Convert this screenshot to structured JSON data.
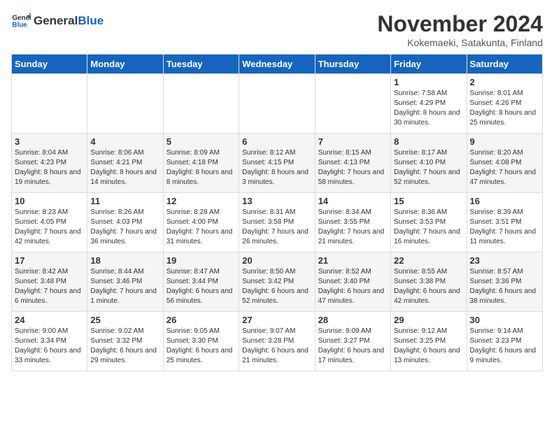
{
  "logo": {
    "general": "General",
    "blue": "Blue"
  },
  "title": "November 2024",
  "location": "Kokemaeki, Satakunta, Finland",
  "days_of_week": [
    "Sunday",
    "Monday",
    "Tuesday",
    "Wednesday",
    "Thursday",
    "Friday",
    "Saturday"
  ],
  "weeks": [
    [
      {
        "day": "",
        "info": ""
      },
      {
        "day": "",
        "info": ""
      },
      {
        "day": "",
        "info": ""
      },
      {
        "day": "",
        "info": ""
      },
      {
        "day": "",
        "info": ""
      },
      {
        "day": "1",
        "info": "Sunrise: 7:58 AM\nSunset: 4:29 PM\nDaylight: 8 hours and 30 minutes."
      },
      {
        "day": "2",
        "info": "Sunrise: 8:01 AM\nSunset: 4:26 PM\nDaylight: 8 hours and 25 minutes."
      }
    ],
    [
      {
        "day": "3",
        "info": "Sunrise: 8:04 AM\nSunset: 4:23 PM\nDaylight: 8 hours and 19 minutes."
      },
      {
        "day": "4",
        "info": "Sunrise: 8:06 AM\nSunset: 4:21 PM\nDaylight: 8 hours and 14 minutes."
      },
      {
        "day": "5",
        "info": "Sunrise: 8:09 AM\nSunset: 4:18 PM\nDaylight: 8 hours and 8 minutes."
      },
      {
        "day": "6",
        "info": "Sunrise: 8:12 AM\nSunset: 4:15 PM\nDaylight: 8 hours and 3 minutes."
      },
      {
        "day": "7",
        "info": "Sunrise: 8:15 AM\nSunset: 4:13 PM\nDaylight: 7 hours and 58 minutes."
      },
      {
        "day": "8",
        "info": "Sunrise: 8:17 AM\nSunset: 4:10 PM\nDaylight: 7 hours and 52 minutes."
      },
      {
        "day": "9",
        "info": "Sunrise: 8:20 AM\nSunset: 4:08 PM\nDaylight: 7 hours and 47 minutes."
      }
    ],
    [
      {
        "day": "10",
        "info": "Sunrise: 8:23 AM\nSunset: 4:05 PM\nDaylight: 7 hours and 42 minutes."
      },
      {
        "day": "11",
        "info": "Sunrise: 8:26 AM\nSunset: 4:03 PM\nDaylight: 7 hours and 36 minutes."
      },
      {
        "day": "12",
        "info": "Sunrise: 8:28 AM\nSunset: 4:00 PM\nDaylight: 7 hours and 31 minutes."
      },
      {
        "day": "13",
        "info": "Sunrise: 8:31 AM\nSunset: 3:58 PM\nDaylight: 7 hours and 26 minutes."
      },
      {
        "day": "14",
        "info": "Sunrise: 8:34 AM\nSunset: 3:55 PM\nDaylight: 7 hours and 21 minutes."
      },
      {
        "day": "15",
        "info": "Sunrise: 8:36 AM\nSunset: 3:53 PM\nDaylight: 7 hours and 16 minutes."
      },
      {
        "day": "16",
        "info": "Sunrise: 8:39 AM\nSunset: 3:51 PM\nDaylight: 7 hours and 11 minutes."
      }
    ],
    [
      {
        "day": "17",
        "info": "Sunrise: 8:42 AM\nSunset: 3:48 PM\nDaylight: 7 hours and 6 minutes."
      },
      {
        "day": "18",
        "info": "Sunrise: 8:44 AM\nSunset: 3:46 PM\nDaylight: 7 hours and 1 minute."
      },
      {
        "day": "19",
        "info": "Sunrise: 8:47 AM\nSunset: 3:44 PM\nDaylight: 6 hours and 56 minutes."
      },
      {
        "day": "20",
        "info": "Sunrise: 8:50 AM\nSunset: 3:42 PM\nDaylight: 6 hours and 52 minutes."
      },
      {
        "day": "21",
        "info": "Sunrise: 8:52 AM\nSunset: 3:40 PM\nDaylight: 6 hours and 47 minutes."
      },
      {
        "day": "22",
        "info": "Sunrise: 8:55 AM\nSunset: 3:38 PM\nDaylight: 6 hours and 42 minutes."
      },
      {
        "day": "23",
        "info": "Sunrise: 8:57 AM\nSunset: 3:36 PM\nDaylight: 6 hours and 38 minutes."
      }
    ],
    [
      {
        "day": "24",
        "info": "Sunrise: 9:00 AM\nSunset: 3:34 PM\nDaylight: 6 hours and 33 minutes."
      },
      {
        "day": "25",
        "info": "Sunrise: 9:02 AM\nSunset: 3:32 PM\nDaylight: 6 hours and 29 minutes."
      },
      {
        "day": "26",
        "info": "Sunrise: 9:05 AM\nSunset: 3:30 PM\nDaylight: 6 hours and 25 minutes."
      },
      {
        "day": "27",
        "info": "Sunrise: 9:07 AM\nSunset: 3:28 PM\nDaylight: 6 hours and 21 minutes."
      },
      {
        "day": "28",
        "info": "Sunrise: 9:09 AM\nSunset: 3:27 PM\nDaylight: 6 hours and 17 minutes."
      },
      {
        "day": "29",
        "info": "Sunrise: 9:12 AM\nSunset: 3:25 PM\nDaylight: 6 hours and 13 minutes."
      },
      {
        "day": "30",
        "info": "Sunrise: 9:14 AM\nSunset: 3:23 PM\nDaylight: 6 hours and 9 minutes."
      }
    ]
  ]
}
